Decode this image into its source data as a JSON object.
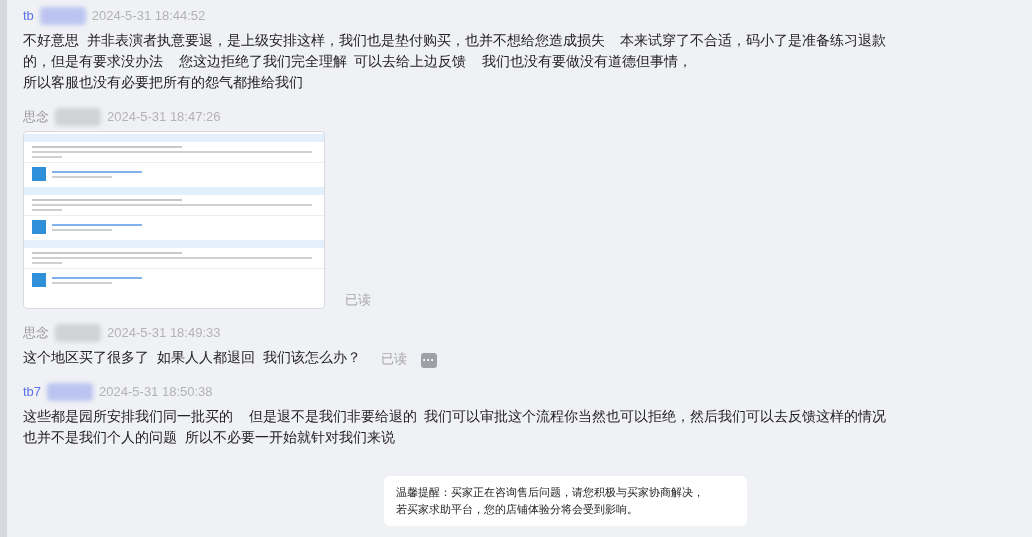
{
  "messages": [
    {
      "kind": "text",
      "sender": "tb",
      "color": "#5a73e6",
      "time": "2024-5-31 18:44:52",
      "lines": [
        "不好意思  并非表演者执意要退，是上级安排这样，我们也是垫付购买，也并不想给您造成损失    本来试穿了不合适，码小了是准备练习退款",
        "的，但是有要求没办法    您这边拒绝了我们完全理解  可以去给上边反馈    我们也没有要做没有道德但事情，",
        "所以客服也没有必要把所有的怨气都推给我们"
      ]
    },
    {
      "kind": "image",
      "sender": "思念",
      "color": "#9a9a9a",
      "time": "2024-5-31 18:47:26",
      "read": "已读"
    },
    {
      "kind": "text",
      "sender": "思念",
      "color": "#9a9a9a",
      "time": "2024-5-31 18:49:33",
      "lines": [
        "这个地区买了很多了  如果人人都退回  我们该怎么办？"
      ],
      "read": "已读",
      "more": "···"
    },
    {
      "kind": "text",
      "sender": "tb7",
      "color": "#5a73e6",
      "time": "2024-5-31 18:50:38",
      "lines": [
        "这些都是园所安排我们同一批买的    但是退不是我们非要给退的  我们可以审批这个流程你当然也可以拒绝，然后我们可以去反馈这样的情况",
        "也并不是我们个人的问题  所以不必要一开始就针对我们来说"
      ]
    }
  ],
  "notice": {
    "lines": [
      "温馨提醒：买家正在咨询售后问题，请您积极与买家协商解决，",
      "若买家求助平台，您的店铺体验分将会受到影响。"
    ]
  }
}
